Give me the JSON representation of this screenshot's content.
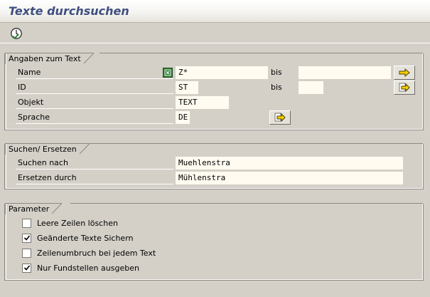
{
  "window": {
    "title": "Texte durchsuchen"
  },
  "toolbar": {
    "execute_icon": "execute-clock-icon"
  },
  "groups": {
    "angaben": {
      "title": "Angaben zum Text",
      "rows": [
        {
          "label": "Name",
          "value": "Z*",
          "bis": "bis",
          "bis_value": ""
        },
        {
          "label": "ID",
          "value": "ST",
          "bis": "bis",
          "bis_value": ""
        },
        {
          "label": "Objekt",
          "value": "TEXT"
        },
        {
          "label": "Sprache",
          "value": "DE"
        }
      ]
    },
    "suchen": {
      "title": "Suchen/ Ersetzen",
      "rows": [
        {
          "label": "Suchen nach",
          "value": "Muehlenstra"
        },
        {
          "label": "Ersetzen durch",
          "value": "Mühlenstra"
        }
      ]
    },
    "parameter": {
      "title": "Parameter",
      "checkboxes": [
        {
          "label": "Leere Zeilen löschen",
          "checked": false
        },
        {
          "label": "Geänderte Texte Sichern",
          "checked": true
        },
        {
          "label": "Zeilenumbruch bei jedem Text",
          "checked": false
        },
        {
          "label": "Nur Fundstellen ausgeben",
          "checked": true
        }
      ]
    }
  },
  "colors": {
    "title": "#3f4f80",
    "background": "#d4d0c8",
    "field": "#fffbf0",
    "arrow": "#f5d000"
  }
}
